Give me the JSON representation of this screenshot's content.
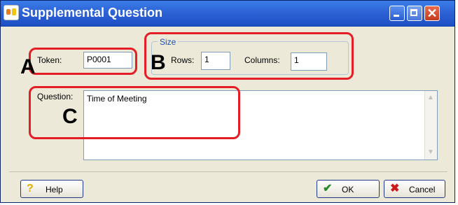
{
  "window": {
    "title": "Supplemental Question"
  },
  "token": {
    "label": "Token:",
    "value": "P0001"
  },
  "size": {
    "title": "Size",
    "rows_label": "Rows:",
    "rows_value": "1",
    "columns_label": "Columns:",
    "columns_value": "1"
  },
  "question": {
    "label": "Question:",
    "value": "Time of Meeting"
  },
  "annotations": {
    "a": "A",
    "b": "B",
    "c": "C"
  },
  "buttons": {
    "help": "Help",
    "ok": "OK",
    "cancel": "Cancel"
  },
  "colors": {
    "titlebar": "#2e63d6",
    "highlight": "#e41e26",
    "face": "#ece9d8"
  },
  "icons": {
    "help": "question-icon",
    "ok": "checkmark-icon",
    "cancel": "x-icon"
  }
}
